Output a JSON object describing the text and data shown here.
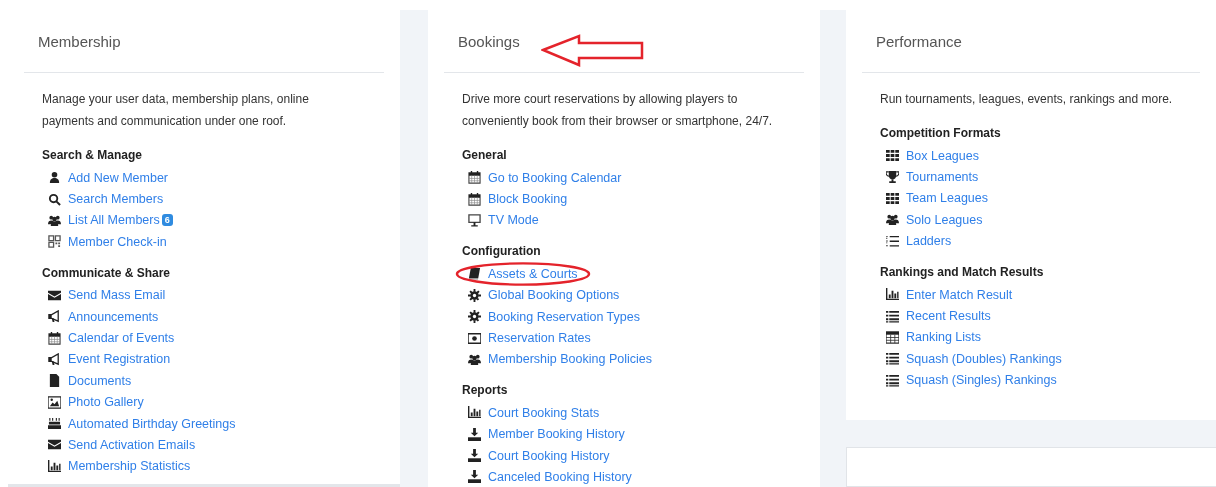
{
  "columns": [
    {
      "title": "Membership",
      "pointer_arrow": false,
      "description": "Manage your user data, membership plans, online payments and communication under one roof.",
      "sections": [
        {
          "heading": "Search & Manage",
          "items": [
            {
              "kind": "user",
              "label": "Add New Member",
              "circled": false
            },
            {
              "kind": "search",
              "label": "Search Members",
              "circled": false
            },
            {
              "kind": "users",
              "label": "List All Members",
              "badge": "6",
              "circled": false
            },
            {
              "kind": "qrcode",
              "label": "Member Check-in",
              "circled": false
            }
          ]
        },
        {
          "heading": "Communicate & Share",
          "items": [
            {
              "kind": "envelope",
              "label": "Send Mass Email",
              "circled": false
            },
            {
              "kind": "bullhorn",
              "label": "Announcements",
              "circled": false
            },
            {
              "kind": "calendar",
              "label": "Calendar of Events",
              "circled": false
            },
            {
              "kind": "bullhorn",
              "label": "Event Registration",
              "circled": false
            },
            {
              "kind": "file",
              "label": "Documents",
              "circled": false
            },
            {
              "kind": "image",
              "label": "Photo Gallery",
              "circled": false
            },
            {
              "kind": "cake",
              "label": "Automated Birthday Greetings",
              "circled": false
            },
            {
              "kind": "envelope",
              "label": "Send Activation Emails",
              "circled": false
            },
            {
              "kind": "chart",
              "label": "Membership Statistics",
              "circled": false
            }
          ]
        }
      ]
    },
    {
      "title": "Bookings",
      "pointer_arrow": true,
      "description": "Drive more court reservations by allowing players to conveniently book from their browser or smartphone, 24/7.",
      "sections": [
        {
          "heading": "General",
          "items": [
            {
              "kind": "calendar",
              "label": "Go to Booking Calendar",
              "circled": false
            },
            {
              "kind": "calendar",
              "label": "Block Booking",
              "circled": false
            },
            {
              "kind": "desktop",
              "label": "TV Mode",
              "circled": false
            }
          ]
        },
        {
          "heading": "Configuration",
          "items": [
            {
              "kind": "book",
              "label": "Assets & Courts",
              "circled": true
            },
            {
              "kind": "gear",
              "label": "Global Booking Options",
              "circled": false
            },
            {
              "kind": "gear",
              "label": "Booking Reservation Types",
              "circled": false
            },
            {
              "kind": "money",
              "label": "Reservation Rates",
              "circled": false
            },
            {
              "kind": "users",
              "label": "Membership Booking Policies",
              "circled": false
            }
          ]
        },
        {
          "heading": "Reports",
          "items": [
            {
              "kind": "chart",
              "label": "Court Booking Stats",
              "circled": false
            },
            {
              "kind": "download",
              "label": "Member Booking History",
              "circled": false
            },
            {
              "kind": "download",
              "label": "Court Booking History",
              "circled": false
            },
            {
              "kind": "download",
              "label": "Canceled Booking History",
              "circled": false
            }
          ]
        }
      ]
    },
    {
      "title": "Performance",
      "pointer_arrow": false,
      "description": "Run tournaments, leagues, events, rankings and more.",
      "sections": [
        {
          "heading": "Competition Formats",
          "items": [
            {
              "kind": "grid",
              "label": "Box Leagues",
              "circled": false
            },
            {
              "kind": "trophy",
              "label": "Tournaments",
              "circled": false
            },
            {
              "kind": "grid",
              "label": "Team Leagues",
              "circled": false
            },
            {
              "kind": "users",
              "label": "Solo Leagues",
              "circled": false
            },
            {
              "kind": "listol",
              "label": "Ladders",
              "circled": false
            }
          ]
        },
        {
          "heading": "Rankings and Match Results",
          "items": [
            {
              "kind": "chart",
              "label": "Enter Match Result",
              "circled": false
            },
            {
              "kind": "list",
              "label": "Recent Results",
              "circled": false
            },
            {
              "kind": "table",
              "label": "Ranking Lists",
              "circled": false
            },
            {
              "kind": "list",
              "label": "Squash (Doubles) Rankings",
              "circled": false
            },
            {
              "kind": "list",
              "label": "Squash (Singles) Rankings",
              "circled": false
            }
          ]
        }
      ]
    }
  ]
}
